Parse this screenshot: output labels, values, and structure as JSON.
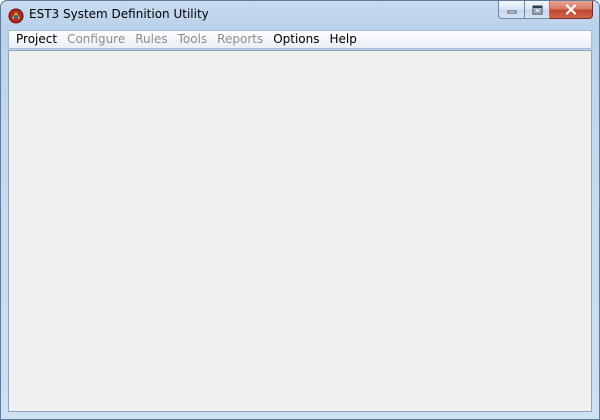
{
  "window": {
    "title": "EST3 System Definition Utility",
    "icon": "est3-app-icon",
    "controls": {
      "minimize_icon": "minimize-icon",
      "maximize_icon": "maximize-icon",
      "close_icon": "close-icon"
    }
  },
  "menubar": {
    "items": [
      {
        "label": "Project",
        "enabled": true
      },
      {
        "label": "Configure",
        "enabled": false
      },
      {
        "label": "Rules",
        "enabled": false
      },
      {
        "label": "Tools",
        "enabled": false
      },
      {
        "label": "Reports",
        "enabled": false
      },
      {
        "label": "Options",
        "enabled": true
      },
      {
        "label": "Help",
        "enabled": true
      }
    ]
  },
  "colors": {
    "disabled_text": "#8d8d8d",
    "client_background": "#f0f0f0",
    "close_button": "#c2452c"
  }
}
